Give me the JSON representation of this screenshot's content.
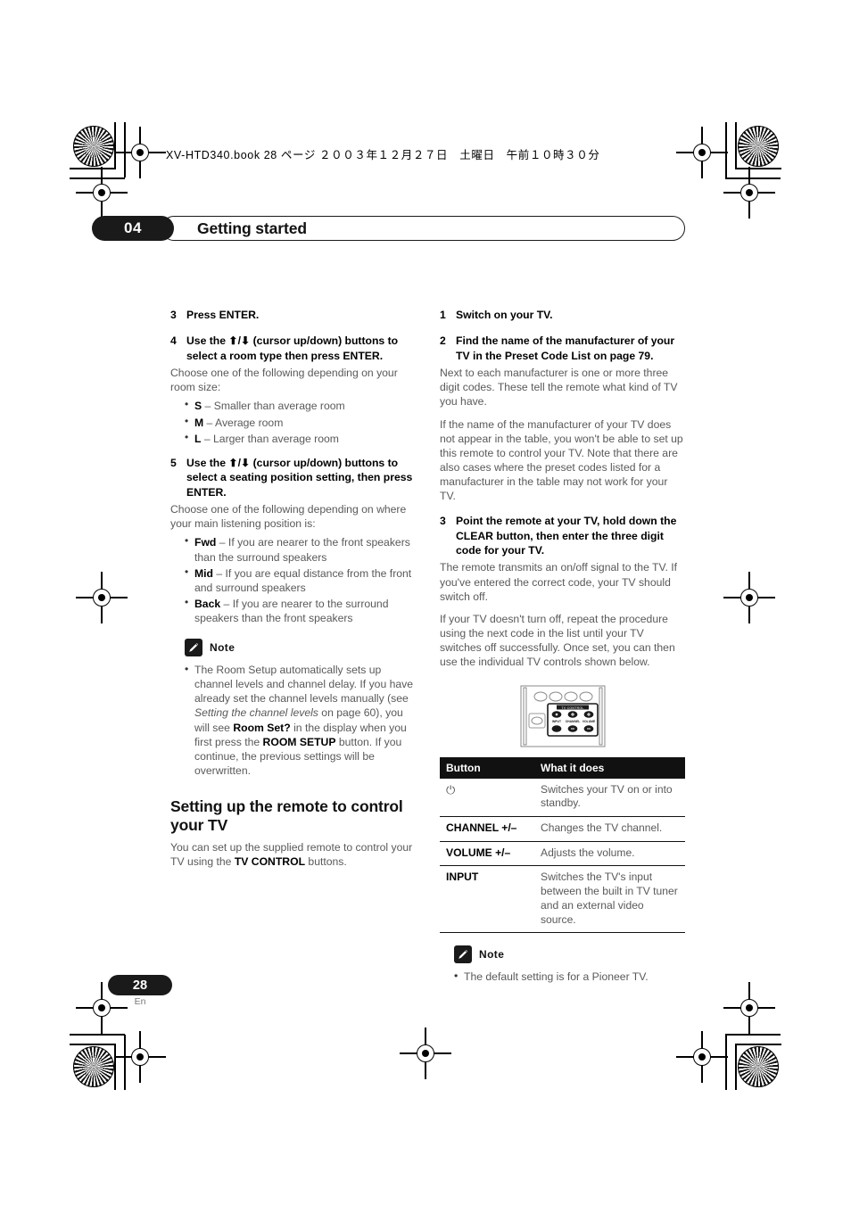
{
  "print_header": {
    "book_line": "XV-HTD340.book  28 ページ  ２００３年１２月２７日　土曜日　午前１０時３０分"
  },
  "chapter": {
    "number": "04",
    "title": "Getting started"
  },
  "left_column": {
    "step3": {
      "num": "3",
      "text": "Press ENTER."
    },
    "step4": {
      "num": "4",
      "text": "Use the ⬆/⬇ (cursor up/down) buttons to select a room type then press ENTER.",
      "body": "Choose one of the following depending on your room size:",
      "bullets": [
        {
          "term": "S",
          "desc": "– Smaller than average room"
        },
        {
          "term": "M",
          "desc": "– Average room"
        },
        {
          "term": "L",
          "desc": "– Larger than average room"
        }
      ]
    },
    "step5": {
      "num": "5",
      "text": "Use the ⬆/⬇ (cursor up/down) buttons to select a seating position setting, then press ENTER.",
      "body": "Choose one of the following depending on where your main listening position is:",
      "bullets": [
        {
          "term": "Fwd",
          "desc": "– If you are nearer to the front speakers than the surround speakers"
        },
        {
          "term": "Mid",
          "desc": "– If you are equal distance from the front and surround speakers"
        },
        {
          "term": "Back",
          "desc": "– If you are nearer to the surround speakers than the front speakers"
        }
      ]
    },
    "note": {
      "label": "Note",
      "icon": "pencil-icon",
      "item_part1": "The Room Setup automatically sets up channel levels and channel delay. If you have already set the channel levels manually (see ",
      "item_italic": "Setting the channel levels",
      "item_part2": " on page 60), you will see ",
      "item_bold1": "Room Set?",
      "item_part3": " in the display when you first press the ",
      "item_bold2": "ROOM SETUP",
      "item_part4": " button. If you continue, the previous settings will be overwritten."
    },
    "section": {
      "heading": "Setting up the remote to control your TV",
      "body_part1": "You can set up the supplied remote to control your TV using the ",
      "body_bold": "TV CONTROL",
      "body_part2": " buttons."
    }
  },
  "right_column": {
    "step1": {
      "num": "1",
      "text": "Switch on your TV."
    },
    "step2": {
      "num": "2",
      "text": "Find the name of the manufacturer of your TV in the Preset Code List on page 79.",
      "para1": "Next to each manufacturer is one or more three digit codes. These tell the remote what kind of TV you have.",
      "para2": "If the name of the manufacturer of your TV does not appear in the table, you won't be able to set up this remote to control your TV. Note that there are also cases where the preset codes listed for a manufacturer in the table may not work for your TV."
    },
    "step3": {
      "num": "3",
      "text": "Point the remote at your TV, hold down the CLEAR button, then enter the three digit code for your TV.",
      "para1": "The remote transmits an on/off signal to the TV. If you've entered the correct code, your TV should switch off.",
      "para2": "If your TV doesn't turn off, repeat the procedure using the next code in the list until your TV switches off successfully. Once set, you can then use the individual TV controls shown below."
    },
    "remote_figure": {
      "label": "TV CONTROL",
      "buttons": [
        "INPUT",
        "CHANNEL",
        "VOLUME"
      ]
    },
    "table": {
      "headers": [
        "Button",
        "What it does"
      ],
      "rows": [
        {
          "button": "⏻",
          "button_is_symbol": true,
          "desc": "Switches your TV on or into standby."
        },
        {
          "button": "CHANNEL +/–",
          "button_is_symbol": false,
          "desc": "Changes the TV channel."
        },
        {
          "button": "VOLUME +/–",
          "button_is_symbol": false,
          "desc": "Adjusts the volume."
        },
        {
          "button": "INPUT",
          "button_is_symbol": false,
          "desc": "Switches the TV's input between the built in TV tuner and an external video source."
        }
      ]
    },
    "note": {
      "label": "Note",
      "icon": "pencil-icon",
      "item": "The default setting is for a Pioneer TV."
    }
  },
  "footer": {
    "page_number": "28",
    "language": "En"
  },
  "colors": {
    "ink_black": "#1a1a1a",
    "body_gray": "#595959",
    "page_white": "#ffffff"
  }
}
